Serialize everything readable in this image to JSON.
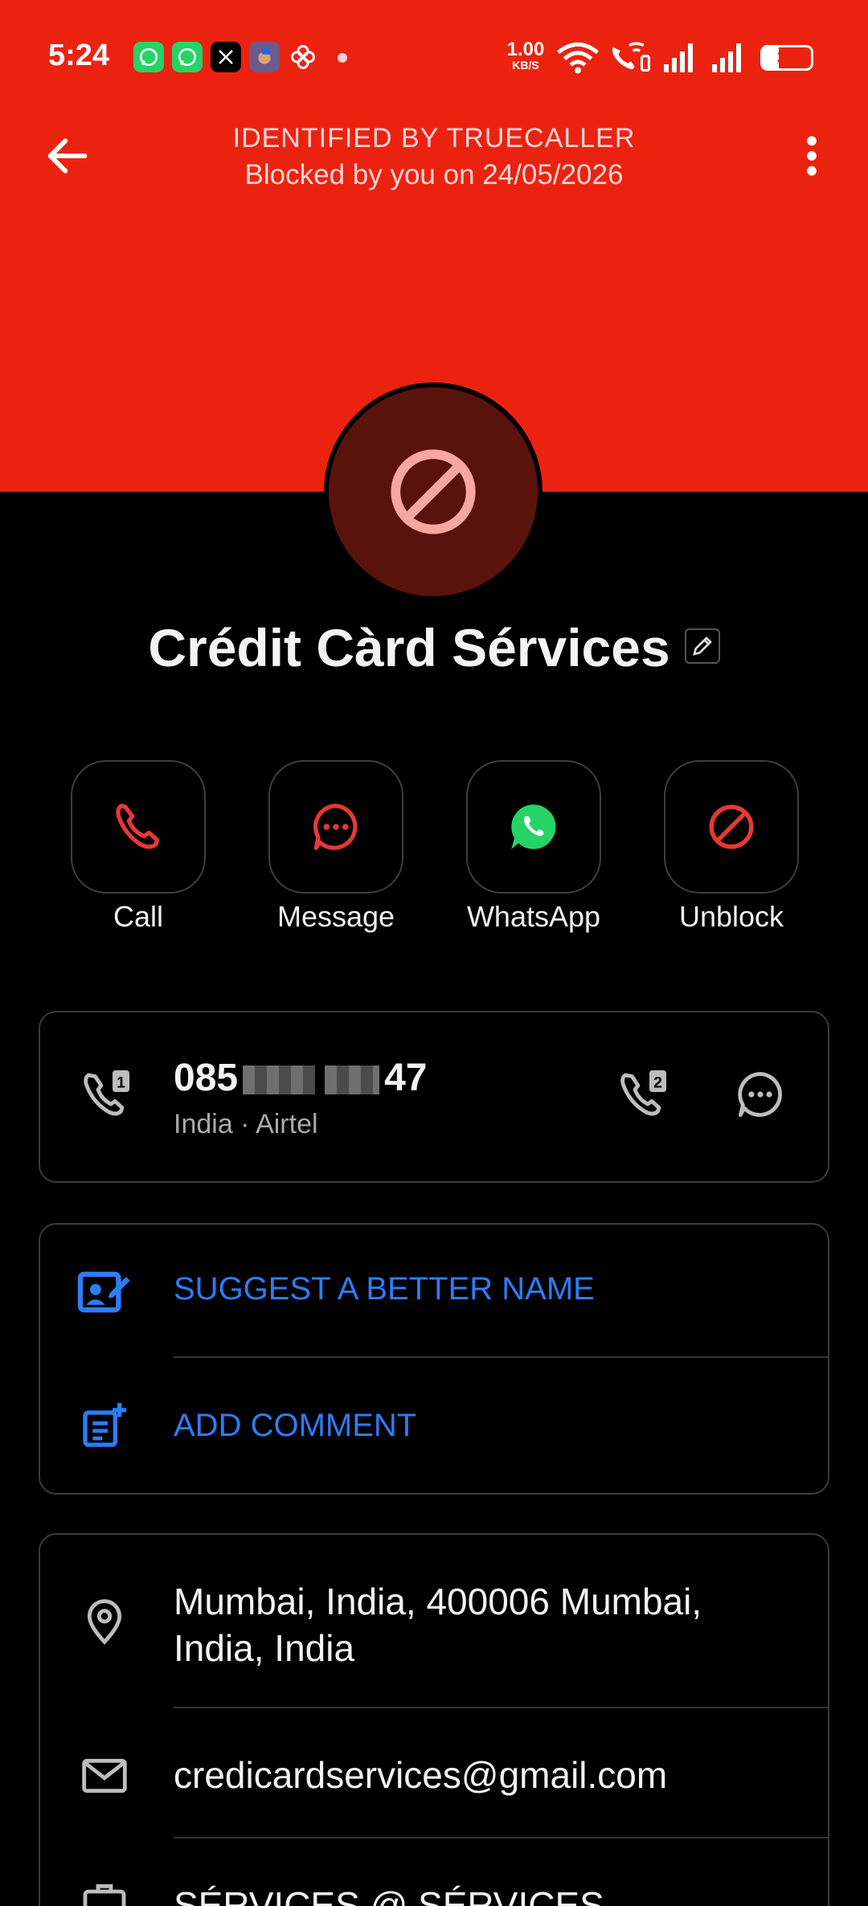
{
  "status_bar": {
    "time": "5:24",
    "net_speed_value": "1.00",
    "net_speed_unit": "KB/S",
    "battery": "33",
    "notification_icons": [
      "whatsapp-icon",
      "whatsapp-business-icon",
      "x-icon",
      "app-icon",
      "pinwheel-icon"
    ]
  },
  "header": {
    "identified": "IDENTIFIED BY TRUECALLER",
    "blocked": "Blocked by you on 24/05/2026",
    "background_color": "#ec2211"
  },
  "contact": {
    "name": "Crédit Càrd Sérvices"
  },
  "actions": [
    {
      "label": "Call",
      "icon": "phone-icon",
      "color": "#e53935"
    },
    {
      "label": "Message",
      "icon": "message-icon",
      "color": "#e53935"
    },
    {
      "label": "WhatsApp",
      "icon": "whatsapp-icon",
      "color": "#25d366"
    },
    {
      "label": "Unblock",
      "icon": "block-icon",
      "color": "#e53935"
    }
  ],
  "phone": {
    "prefix": "085",
    "suffix": "47",
    "sub": "India · Airtel"
  },
  "suggest": {
    "suggest_name": "SUGGEST A BETTER NAME",
    "add_comment": "ADD COMMENT",
    "accent": "#2d7df6"
  },
  "info": {
    "address_line1": "Mumbai, India, 400006 Mumbai,",
    "address_line2": "India, India",
    "email": "credicardservices@gmail.com",
    "job": "SÉRVICES @ SÉRVICES"
  }
}
